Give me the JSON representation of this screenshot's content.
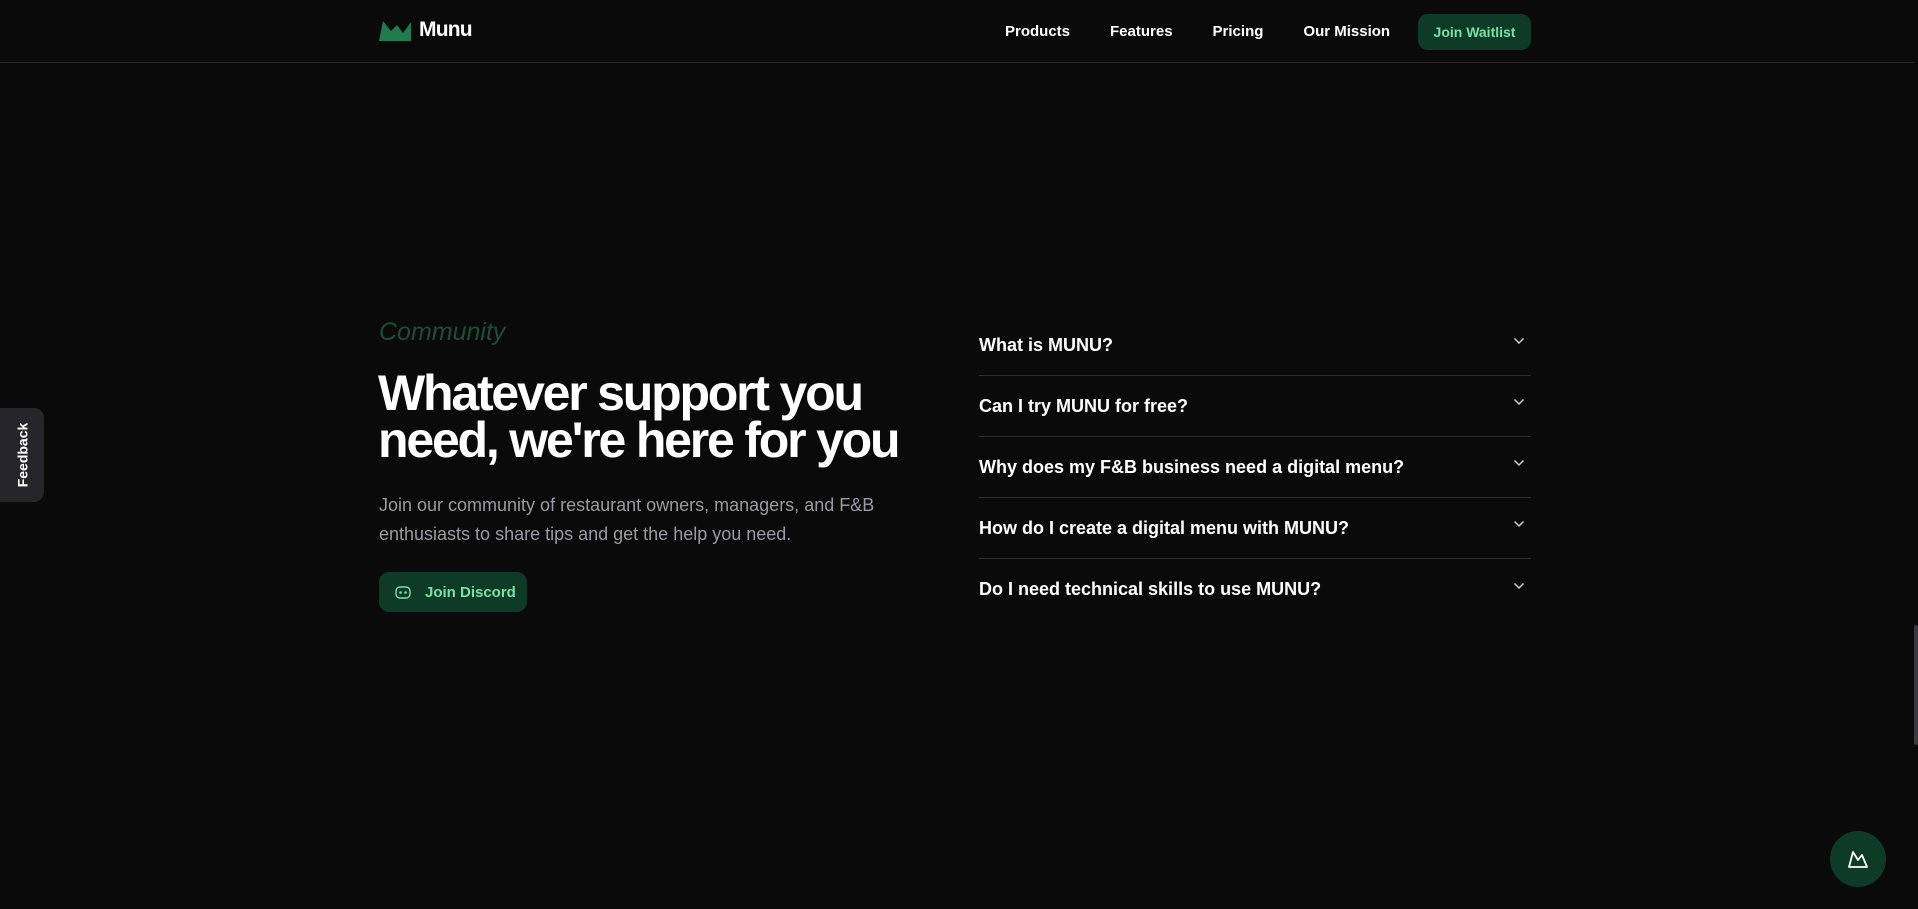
{
  "header": {
    "logo_text": "Munu",
    "nav": [
      "Products",
      "Features",
      "Pricing",
      "Our Mission"
    ],
    "cta_label": "Join Waitlist"
  },
  "hero": {
    "eyebrow": "Community",
    "headline": "Whatever support you need, we're here for you",
    "subtext": "Join our community of restaurant owners, managers, and F&B enthusiasts to share tips and get the help you need.",
    "discord_label": "Join Discord"
  },
  "faq": [
    {
      "question": "What is MUNU?"
    },
    {
      "question": "Can I try MUNU for free?"
    },
    {
      "question": "Why does my F&B business need a digital menu?"
    },
    {
      "question": "How do I create a digital menu with MUNU?"
    },
    {
      "question": "Do I need technical skills to use MUNU?"
    }
  ],
  "feedback_label": "Feedback",
  "icons": {
    "logo": "mountain-logo-icon",
    "discord": "discord-icon",
    "faq_toggle": "chevron-down-icon",
    "chat": "mountain-chat-icon"
  },
  "colors": {
    "background": "#0a0a0a",
    "accent_bg": "#0e3b27",
    "accent_text": "#7ee0a1",
    "eyebrow": "#1f4d36",
    "muted_text": "#9a9aa2"
  }
}
